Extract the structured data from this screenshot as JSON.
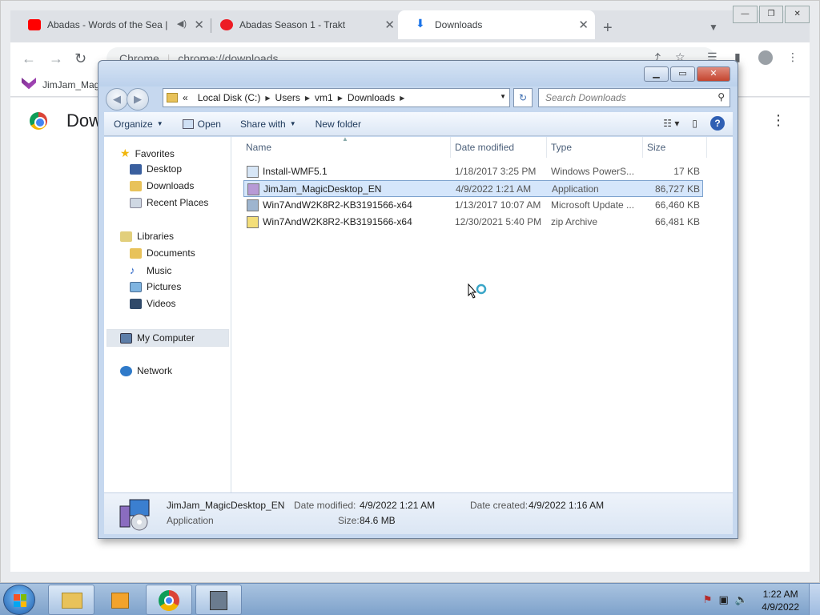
{
  "browser": {
    "tabs": [
      {
        "label": "Abadas - Words of the Sea |",
        "close": "✕",
        "color": "#ff0000"
      },
      {
        "label": "Abadas Season 1 - Trakt",
        "close": "✕",
        "color": "#ed1c24"
      },
      {
        "label": "Downloads",
        "close": "✕",
        "color": "#1a73e8"
      }
    ],
    "new_tab": "+",
    "omnibox_prefix": "Chrome",
    "omnibox_url": "chrome://downloads",
    "bookmark": "JimJam_Magic",
    "page_title": "Dow",
    "window_controls": [
      "—",
      "❐",
      "✕"
    ]
  },
  "explorer": {
    "address": {
      "root": "«",
      "crumbs": [
        "Local Disk (C:)",
        "Users",
        "vm1",
        "Downloads"
      ]
    },
    "search_placeholder": "Search Downloads",
    "toolbar": {
      "organize": "Organize",
      "open": "Open",
      "share": "Share with",
      "new_folder": "New folder"
    },
    "nav": {
      "favorites": "Favorites",
      "desktop": "Desktop",
      "downloads": "Downloads",
      "recent": "Recent Places",
      "libraries": "Libraries",
      "documents": "Documents",
      "music": "Music",
      "pictures": "Pictures",
      "videos": "Videos",
      "computer": "My Computer",
      "network": "Network"
    },
    "columns": {
      "name": "Name",
      "date": "Date modified",
      "type": "Type",
      "size": "Size"
    },
    "files": [
      {
        "name": "Install-WMF5.1",
        "date": "1/18/2017 3:25 PM",
        "type": "Windows PowerS...",
        "size": "17 KB"
      },
      {
        "name": "JimJam_MagicDesktop_EN",
        "date": "4/9/2022 1:21 AM",
        "type": "Application",
        "size": "86,727 KB"
      },
      {
        "name": "Win7AndW2K8R2-KB3191566-x64",
        "date": "1/13/2017 10:07 AM",
        "type": "Microsoft Update ...",
        "size": "66,460 KB"
      },
      {
        "name": "Win7AndW2K8R2-KB3191566-x64",
        "date": "12/30/2021 5:40 PM",
        "type": "zip Archive",
        "size": "66,481 KB"
      }
    ],
    "details": {
      "name": "JimJam_MagicDesktop_EN",
      "type": "Application",
      "modified_label": "Date modified:",
      "modified": "4/9/2022 1:21 AM",
      "created_label": "Date created:",
      "created": "4/9/2022 1:16 AM",
      "size_label": "Size:",
      "size": "84.6 MB"
    }
  },
  "taskbar": {
    "time": "1:22 AM",
    "date": "4/9/2022"
  }
}
